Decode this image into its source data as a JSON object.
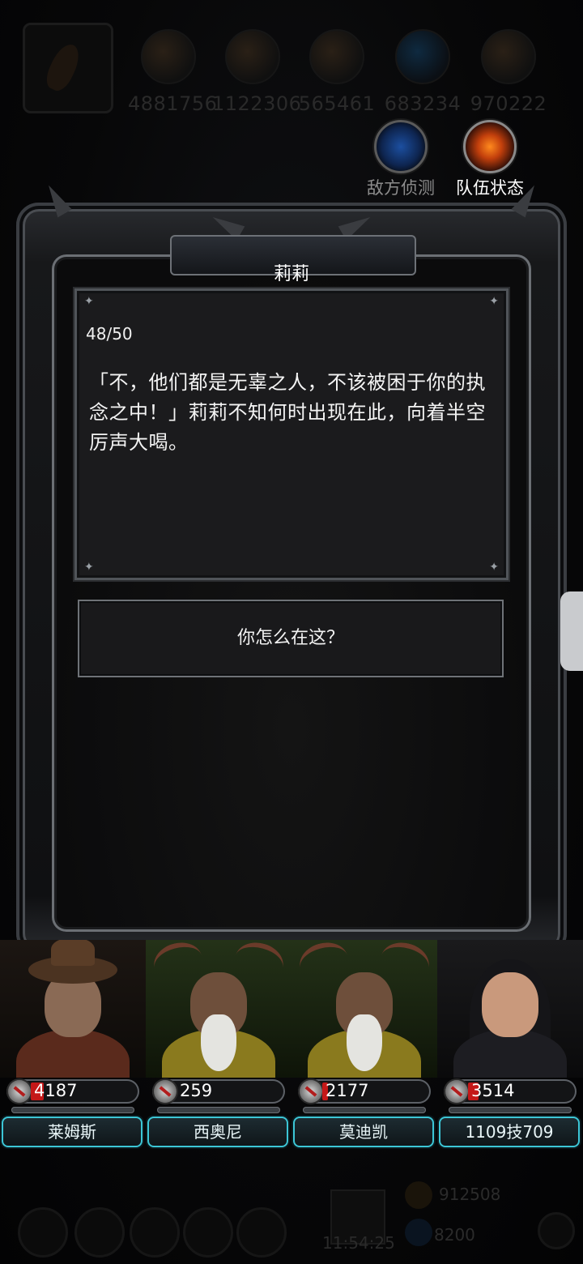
{
  "hud": {
    "resources": [
      {
        "icon": "orb-orange-icon",
        "value": "4881756"
      },
      {
        "icon": "orb-gold-icon",
        "value": "1122306"
      },
      {
        "icon": "orb-gray-icon",
        "value": "565461"
      },
      {
        "icon": "orb-blue-icon",
        "value": "683234"
      },
      {
        "icon": "orb-dark-icon",
        "value": "970222"
      }
    ],
    "enemy_scout_label": "敌方侦测",
    "team_status_label": "队伍状态"
  },
  "dialog": {
    "speaker": "莉莉",
    "progress": "48/50",
    "text": "「不，他们都是无辜之人，不该被困于你的执念之中！」莉莉不知何时出现在此，向着半空厉声大喝。",
    "choice": "你怎么在这？"
  },
  "party": [
    {
      "name": "莱姆斯",
      "power": "4187",
      "power_fill": 0.12
    },
    {
      "name": "西奥尼",
      "power": "259",
      "power_fill": 0.0
    },
    {
      "name": "莫迪凯",
      "power": "2177",
      "power_fill": 0.05
    },
    {
      "name": "1109技709",
      "power": "3514",
      "power_fill": 0.1
    }
  ],
  "bottom": {
    "gold": "912508",
    "gems": "8200",
    "time": "11:54:25"
  },
  "colors": {
    "accent_cyan": "#3cc6d6",
    "power_red": "#c41818",
    "frame_silver": "#6b6f74"
  }
}
